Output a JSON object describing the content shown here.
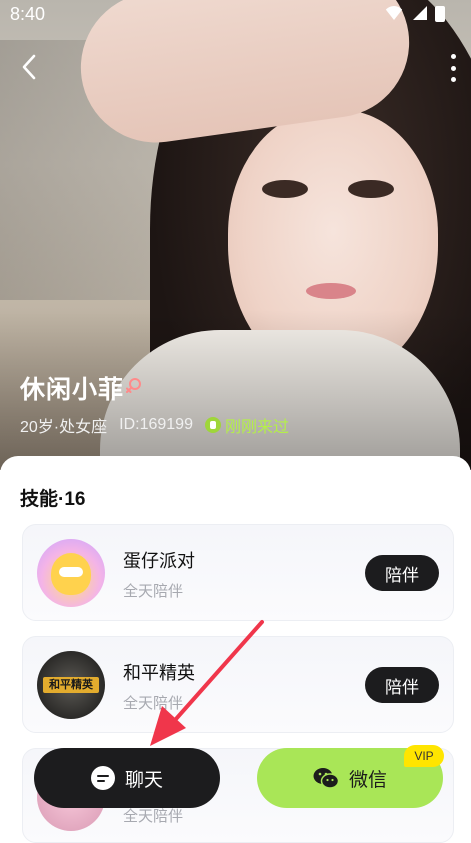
{
  "status_bar": {
    "time": "8:40"
  },
  "profile": {
    "name": "休闲小菲",
    "age_sign": "20岁·处女座",
    "id_text": "ID:169199",
    "online_text": "刚刚来过"
  },
  "skills": {
    "title": "技能·16",
    "items": [
      {
        "title": "蛋仔派对",
        "subtitle": "全天陪伴",
        "button": "陪伴",
        "avatar_text": ""
      },
      {
        "title": "和平精英",
        "subtitle": "全天陪伴",
        "button": "陪伴",
        "avatar_text": "和平精英"
      },
      {
        "title": "",
        "subtitle": "全天陪伴",
        "button": "",
        "avatar_text": ""
      }
    ]
  },
  "actions": {
    "chat_label": "聊天",
    "wechat_label": "微信",
    "vip_label": "VIP"
  },
  "colors": {
    "accent_green": "#a9e657",
    "dark_button": "#1c1c1e",
    "vip_yellow": "#ffe500",
    "arrow_red": "#f0364b"
  }
}
